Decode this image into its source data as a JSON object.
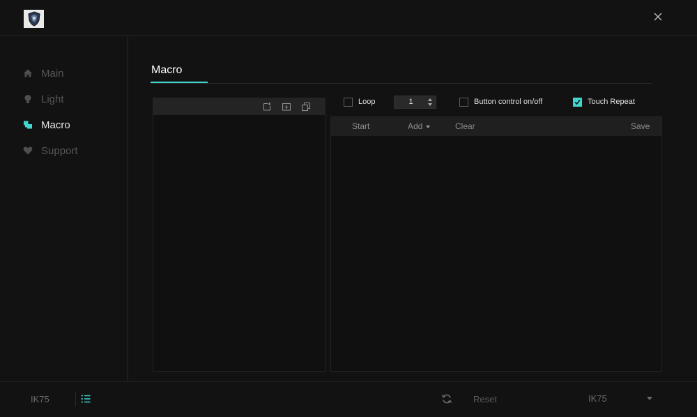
{
  "window": {
    "logo_icon": "shield-logo-icon",
    "close_icon": "close-icon"
  },
  "sidebar": {
    "items": [
      {
        "label": "Main",
        "icon": "home-icon",
        "active": false
      },
      {
        "label": "Light",
        "icon": "bulb-icon",
        "active": false
      },
      {
        "label": "Macro",
        "icon": "macro-icon",
        "active": true
      },
      {
        "label": "Support",
        "icon": "heart-icon",
        "active": false
      }
    ]
  },
  "main": {
    "title": "Macro",
    "macro_list": {
      "toolbar_icons": [
        "new-file-icon",
        "import-folder-icon",
        "copy-icon"
      ]
    },
    "options": {
      "loop_label": "Loop",
      "loop_checked": false,
      "loop_count": "1",
      "button_control_label": "Button control on/off",
      "button_control_checked": false,
      "touch_repeat_label": "Touch Repeat",
      "touch_repeat_checked": true
    },
    "editor_toolbar": {
      "start_label": "Start",
      "add_label": "Add",
      "clear_label": "Clear",
      "save_label": "Save"
    }
  },
  "footer": {
    "device_name": "IK75",
    "list_icon": "list-icon",
    "refresh_icon": "refresh-icon",
    "reset_label": "Reset",
    "profile_value": "IK75"
  },
  "colors": {
    "accent": "#3fd6cf",
    "background": "#121212",
    "panel": "#101010",
    "toolbar": "#242424"
  }
}
